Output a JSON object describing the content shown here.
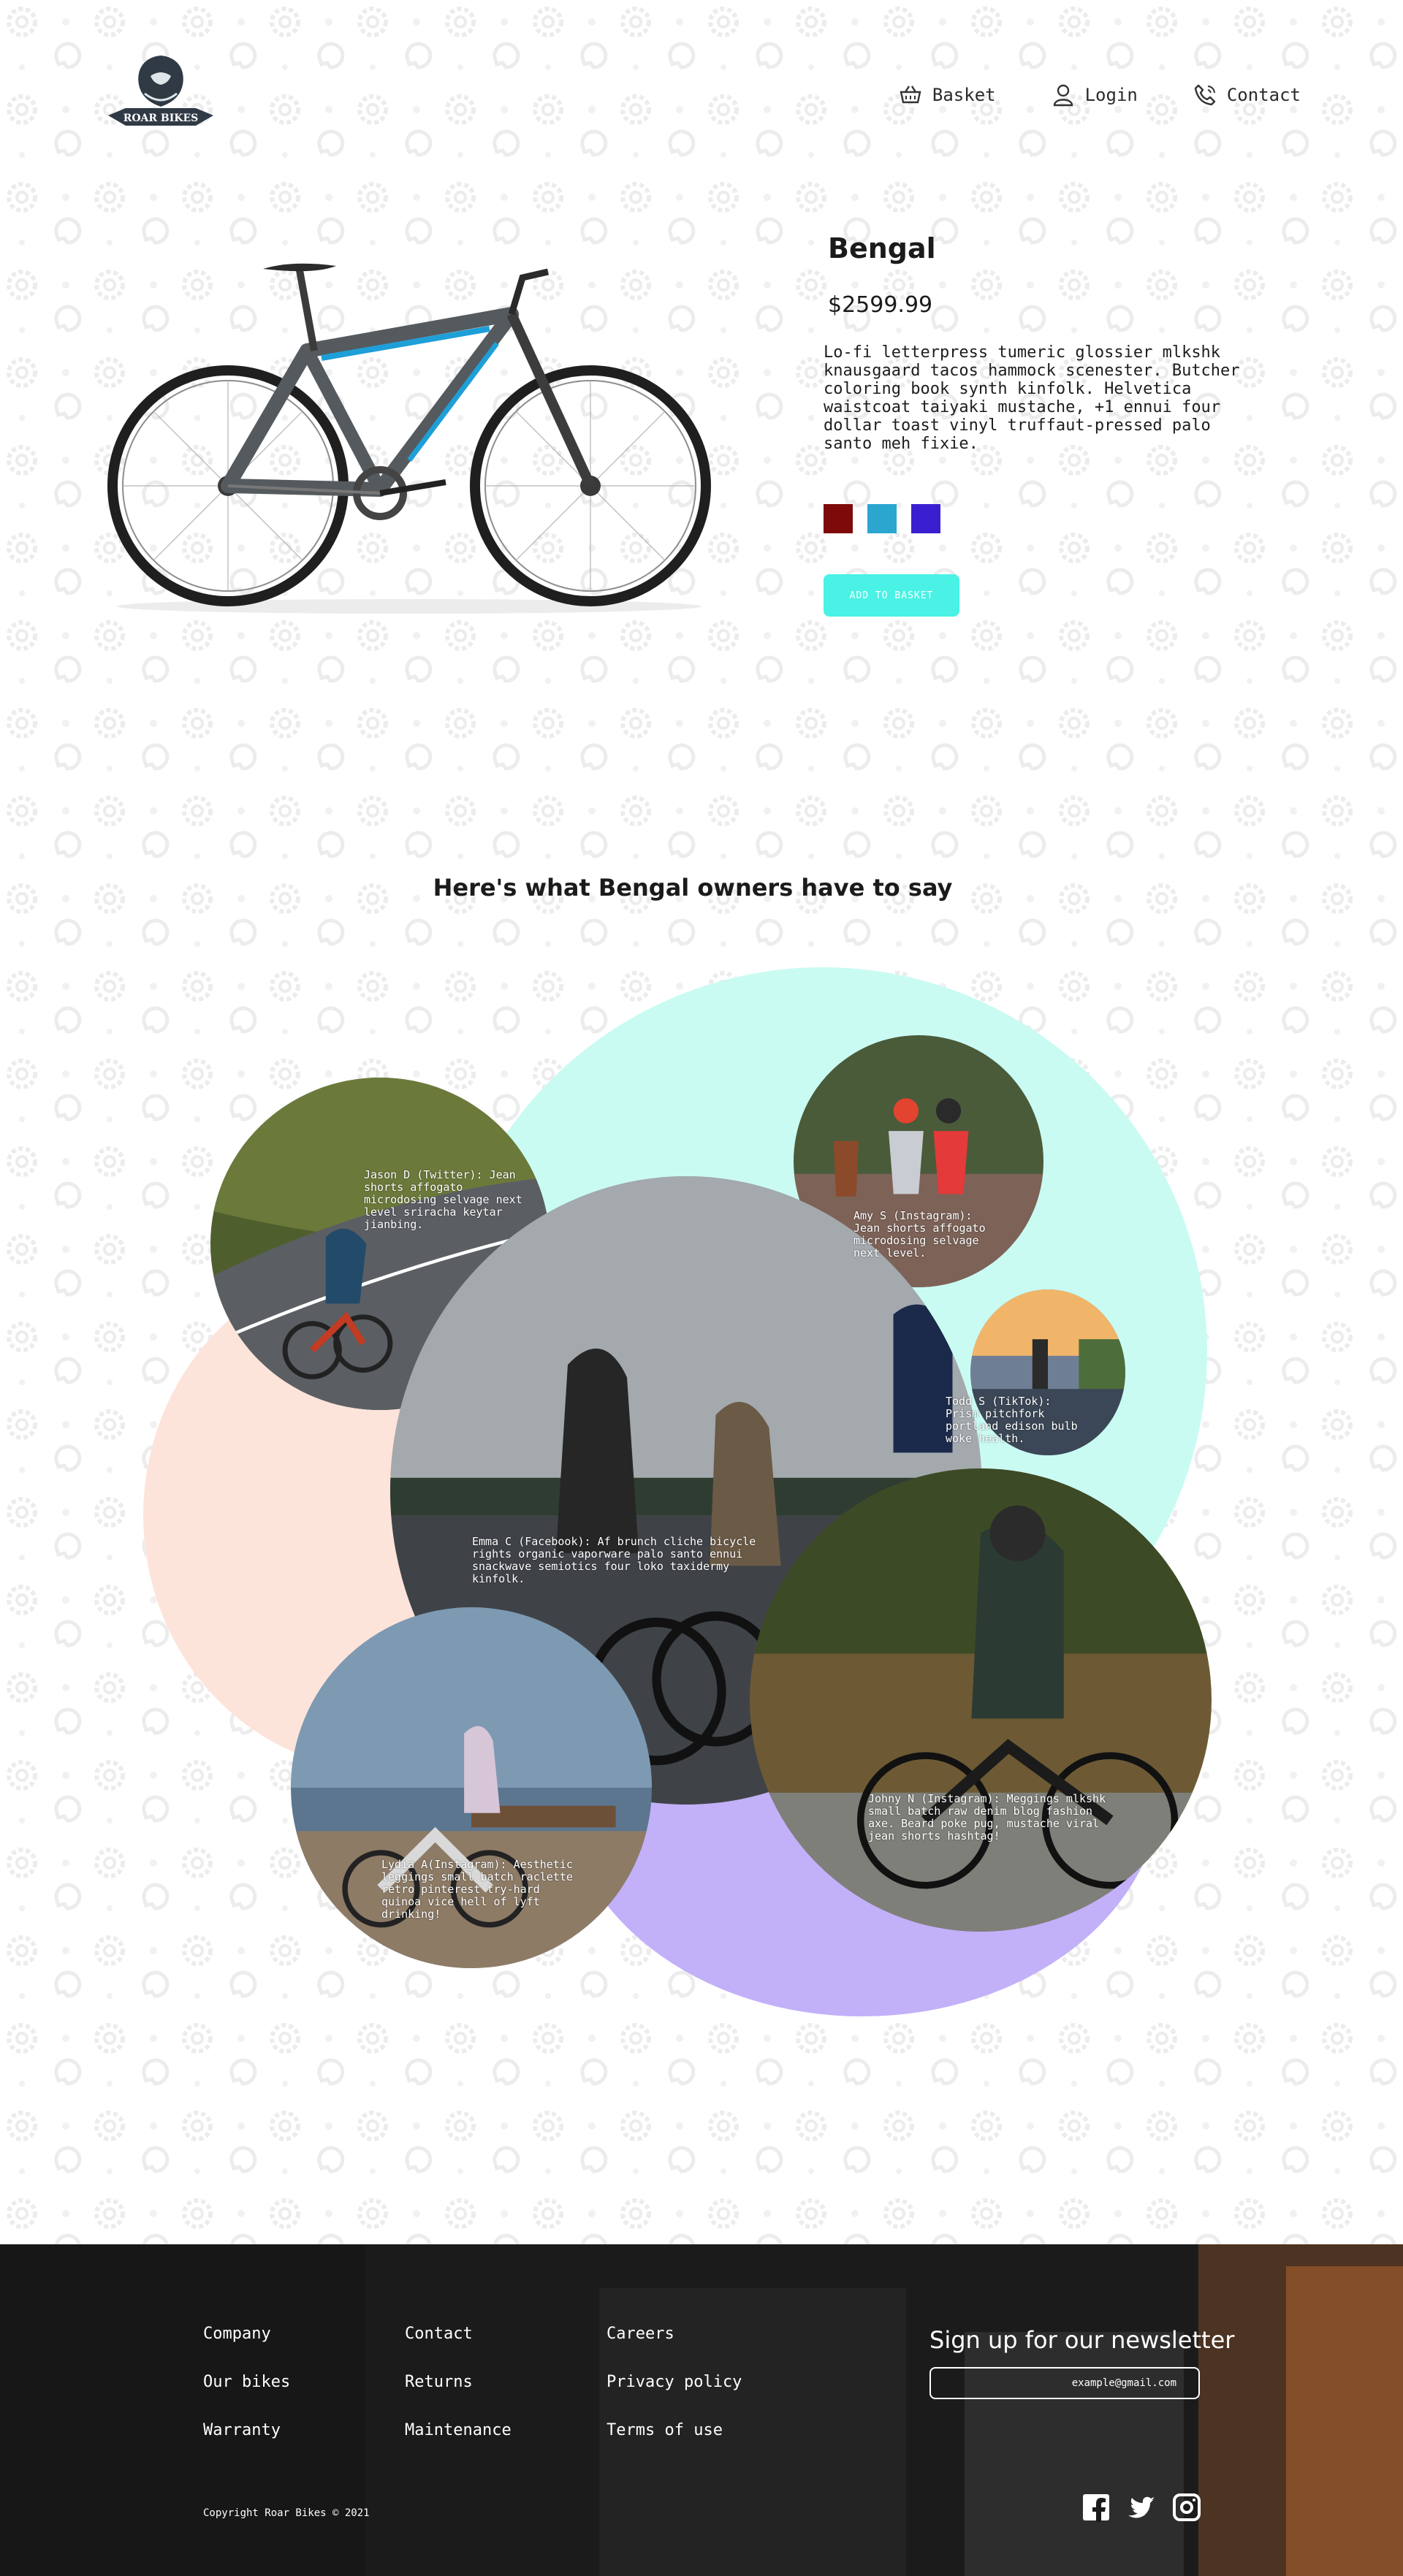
{
  "colors": {
    "accent": "#49f2e4",
    "blob_mint": "#cafbf3",
    "blob_peach": "#fde4da",
    "blob_lavender": "#c2b0f9",
    "pattern": "#ececec",
    "footer": "#191919"
  },
  "header": {
    "logo_text": "ROAR BIKES",
    "nav": [
      {
        "label": "Basket",
        "icon": "basket-icon"
      },
      {
        "label": "Login",
        "icon": "user-icon"
      },
      {
        "label": "Contact",
        "icon": "phone-icon"
      }
    ]
  },
  "product": {
    "name": "Bengal",
    "price": "$2599.99",
    "description": "Lo-fi letterpress tumeric glossier mlkshk knausgaard tacos hammock scenester. Butcher coloring book synth kinfolk. Helvetica waistcoat taiyaki mustache, +1 ennui four dollar toast vinyl truffaut-pressed palo santo meh fixie.",
    "colors": [
      "#7f0a0a",
      "#2aa6cf",
      "#3a1fd1"
    ],
    "add_label": "ADD TO BASKET"
  },
  "testimonials": {
    "heading": "Here's what Bengal owners have to say",
    "items": [
      {
        "text": "Jason D (Twitter): Jean shorts affogato microdosing selvage next level sriracha keytar jianbing."
      },
      {
        "text": "Amy S (Instagram): Jean shorts affogato microdosing selvage next level."
      },
      {
        "text": "Todd S (TikTok): Prism pitchfork portland edison bulb woke health."
      },
      {
        "text": "Emma C (Facebook): Af brunch cliche bicycle rights organic vaporware palo santo ennui snackwave semiotics four loko taxidermy kinfolk."
      },
      {
        "text": "Lydia A(Instagram): Aesthetic leggings small batch raclette retro pinterest try-hard quinoa vice hell of lyft drinking!"
      },
      {
        "text": "Johny N (Instagram): Meggings mlkshk small batch raw denim blog fashion axe. Beard poke pug, mustache viral jean shorts hashtag!"
      }
    ]
  },
  "footer": {
    "col1": [
      "Company",
      "Our bikes",
      "Warranty"
    ],
    "col2": [
      "Contact",
      "Returns",
      "Maintenance"
    ],
    "col3": [
      "Careers",
      "Privacy policy",
      "Terms of use"
    ],
    "newsletter_title": "Sign up for our newsletter",
    "newsletter_placeholder": "example@gmail.com",
    "copyright": "Copyright Roar Bikes © 2021",
    "social": [
      "facebook-icon",
      "twitter-icon",
      "instagram-icon"
    ]
  }
}
